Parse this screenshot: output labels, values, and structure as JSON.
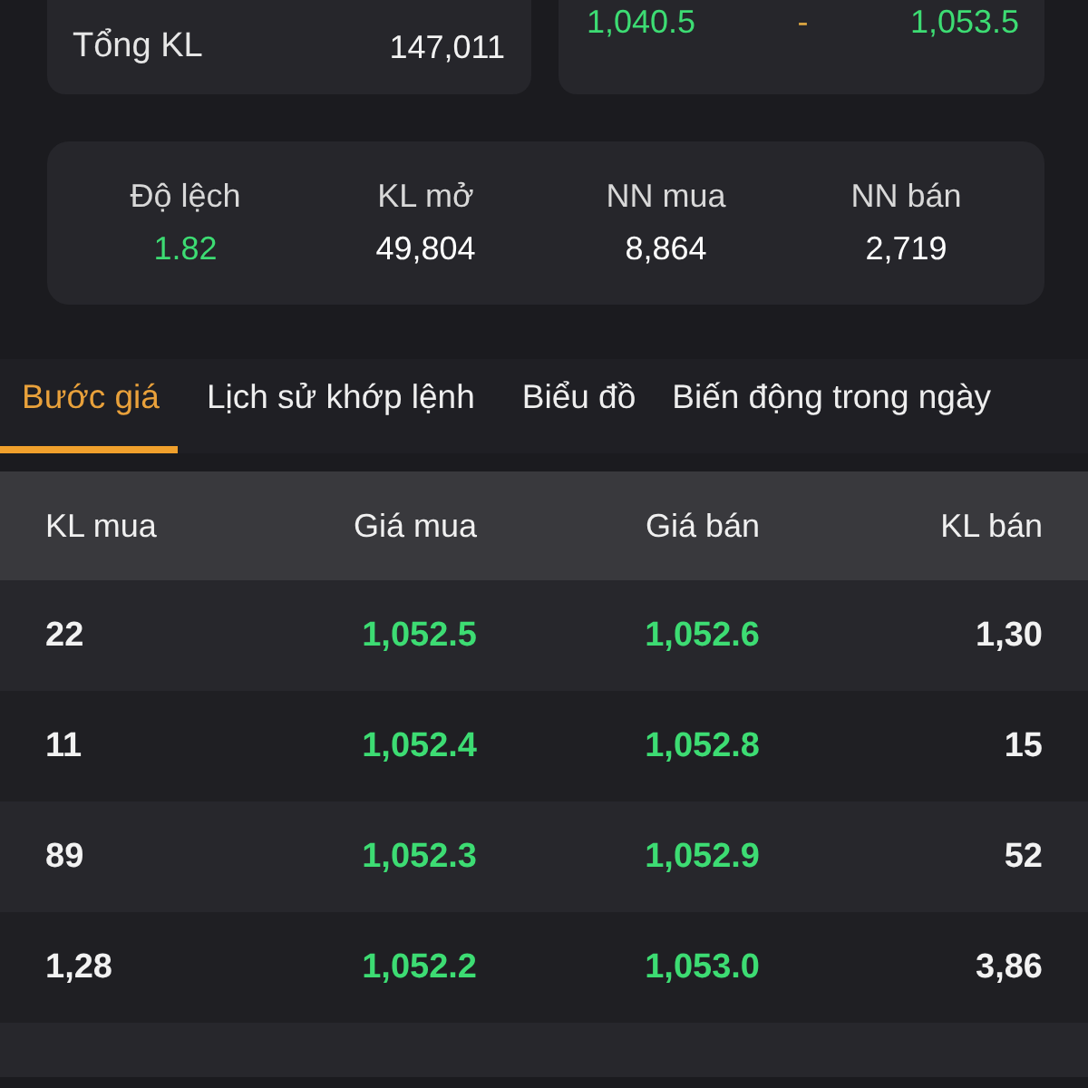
{
  "summary_cards": [
    {
      "kind": "total",
      "label": "Tổng KL",
      "value": "147,011"
    },
    {
      "kind": "range",
      "low": "1,040.5",
      "separator": "-",
      "high": "1,053.5"
    }
  ],
  "stats": [
    {
      "label": "Độ lệch",
      "value": "1.82",
      "color": "#3ddc73"
    },
    {
      "label": "KL mở",
      "value": "49,804",
      "color": "#ffffff"
    },
    {
      "label": "NN mua",
      "value": "8,864",
      "color": "#ffffff"
    },
    {
      "label": "NN bán",
      "value": "2,719",
      "color": "#ffffff"
    }
  ],
  "tabs": [
    {
      "label": "Bước giá",
      "selected": true
    },
    {
      "label": "Lịch sử khớp lệnh",
      "selected": false
    },
    {
      "label": "Biểu đồ",
      "selected": false
    },
    {
      "label": "Biến động trong ngày",
      "selected": false
    }
  ],
  "table": {
    "columns": [
      "KL mua",
      "Giá mua",
      "Giá bán",
      "KL bán"
    ],
    "rows": [
      [
        "22",
        "1,052.5",
        "1,052.6",
        "1,30"
      ],
      [
        "11",
        "1,052.4",
        "1,052.8",
        "15"
      ],
      [
        "89",
        "1,052.3",
        "1,052.9",
        "52"
      ],
      [
        "1,28",
        "1,052.2",
        "1,053.0",
        "3,86"
      ]
    ]
  }
}
